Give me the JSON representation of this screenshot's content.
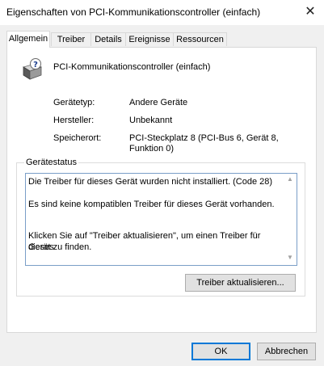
{
  "window": {
    "title": "Eigenschaften von PCI-Kommunikationscontroller (einfach)",
    "close_glyph": "✕"
  },
  "tabs": [
    {
      "label": "Allgemein",
      "active": true
    },
    {
      "label": "Treiber",
      "active": false
    },
    {
      "label": "Details",
      "active": false
    },
    {
      "label": "Ereignisse",
      "active": false
    },
    {
      "label": "Ressourcen",
      "active": false
    }
  ],
  "device": {
    "icon": "unknown-device-icon",
    "name": "PCI-Kommunikationscontroller (einfach)"
  },
  "properties": {
    "type_label": "Gerätetyp:",
    "type_value": "Andere Geräte",
    "manufacturer_label": "Hersteller:",
    "manufacturer_value": "Unbekannt",
    "location_label": "Speicherort:",
    "location_value_line1": "PCI-Steckplatz 8 (PCI-Bus 6, Gerät 8,",
    "location_value_line2": "Funktion 0)"
  },
  "status": {
    "group_title": "Gerätestatus",
    "line1": "Die Treiber für dieses Gerät wurden nicht installiert. (Code 28)",
    "line2": "Es sind keine kompatiblen Treiber für dieses Gerät vorhanden.",
    "line3": "Klicken Sie auf \"Treiber aktualisieren\", um einen Treiber für dieses",
    "line4": "Gerät zu finden.",
    "scroll_up": "▲",
    "scroll_down": "▼"
  },
  "buttons": {
    "update_driver": "Treiber aktualisieren...",
    "ok": "OK",
    "cancel": "Abbrechen"
  },
  "colors": {
    "accent": "#0078d7",
    "status_border": "#7a9ec7"
  }
}
